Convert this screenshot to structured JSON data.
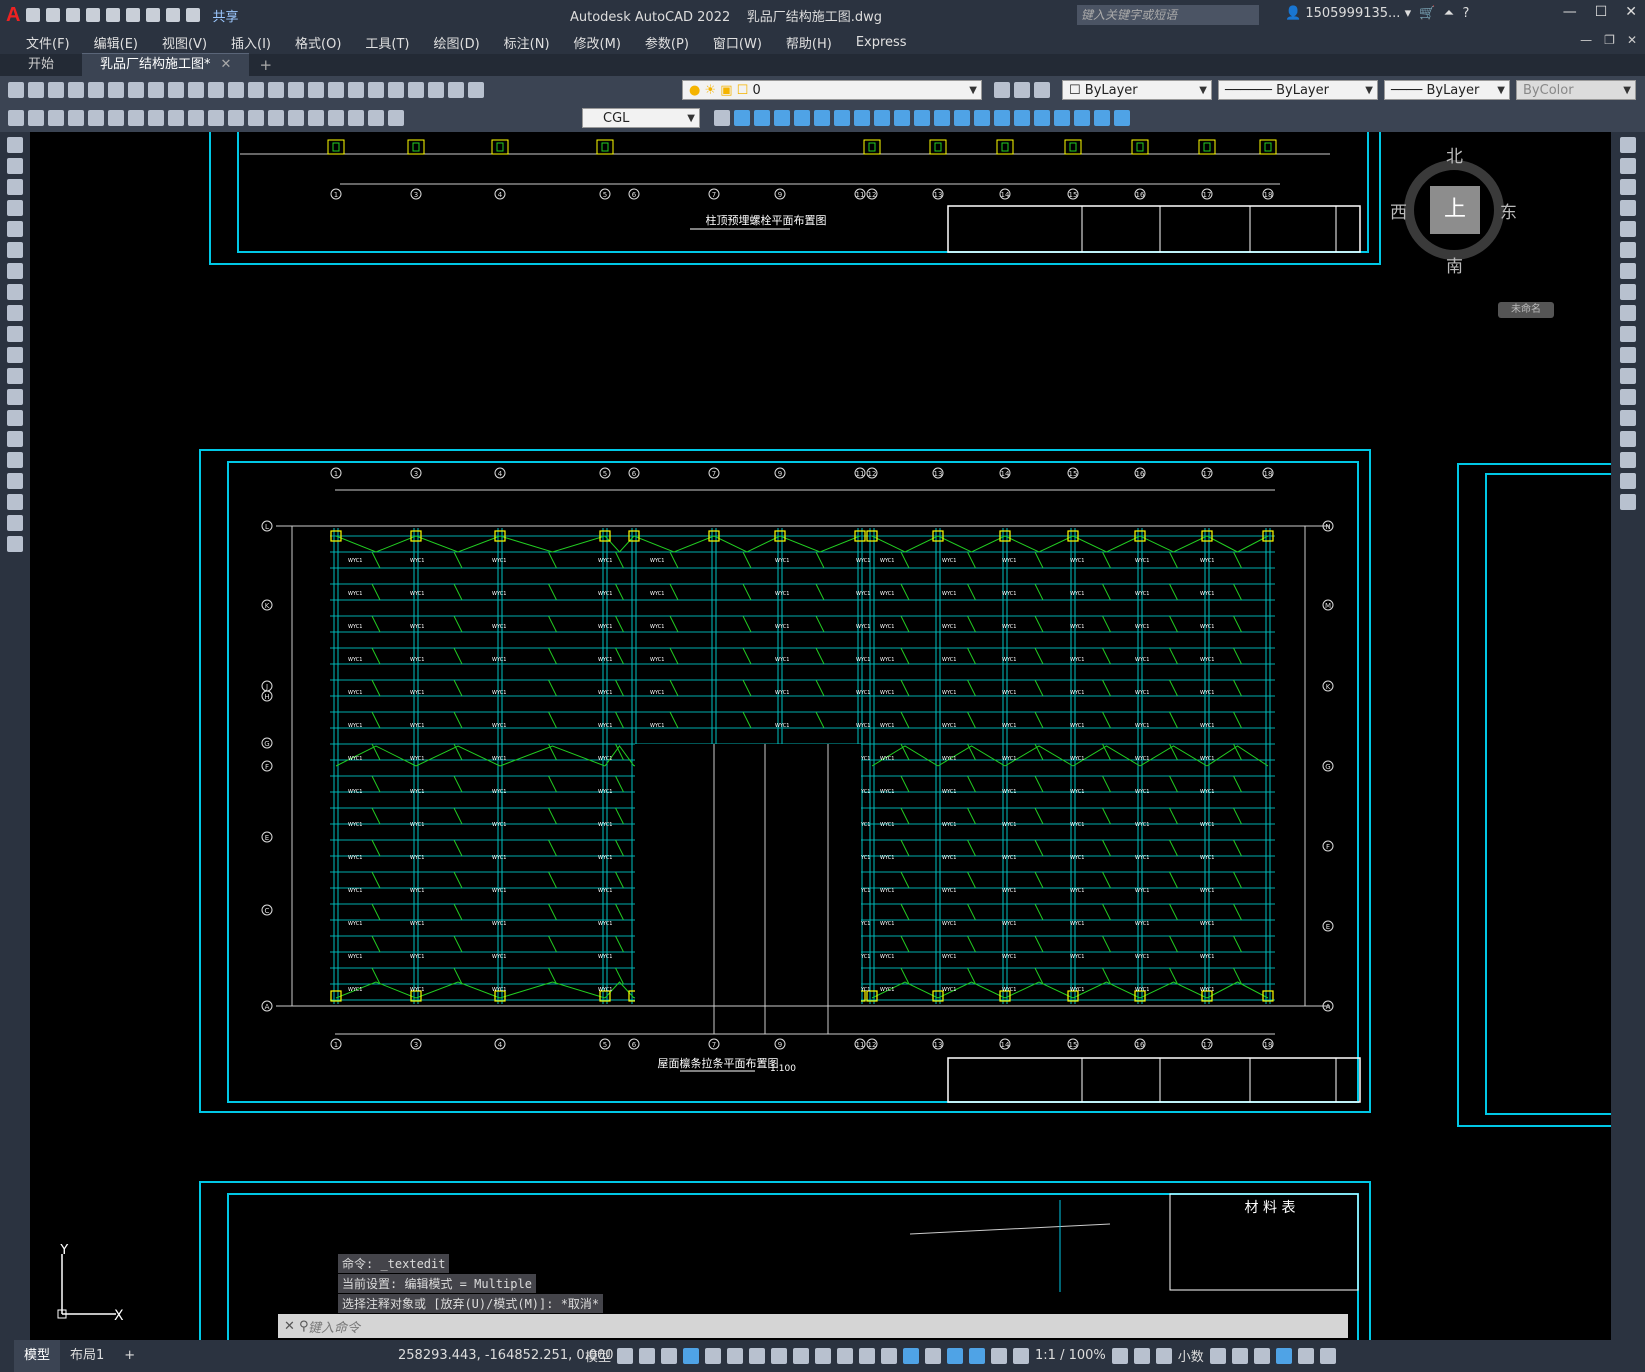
{
  "titlebar": {
    "app_title": "Autodesk AutoCAD 2022",
    "doc_title": "乳品厂结构施工图.dwg",
    "search_placeholder": "键入关键字或短语",
    "user": "1505999135...",
    "share_label": "共享"
  },
  "menu": [
    "文件(F)",
    "编辑(E)",
    "视图(V)",
    "插入(I)",
    "格式(O)",
    "工具(T)",
    "绘图(D)",
    "标注(N)",
    "修改(M)",
    "参数(P)",
    "窗口(W)",
    "帮助(H)",
    "Express"
  ],
  "tabs": {
    "start": "开始",
    "doc": "乳品厂结构施工图*"
  },
  "toolbar": {
    "layer_value": "0",
    "color_value": "ByLayer",
    "linetype_value": "ByLayer",
    "lineweight_value": "ByLayer",
    "plotstyle_value": "ByColor",
    "dimstyle_value": "CGL"
  },
  "viewcube": {
    "north": "北",
    "south": "南",
    "east": "东",
    "west": "西",
    "face": "上",
    "wcs": "未命名"
  },
  "drawing": {
    "title_top": "柱顶预埋螺栓平面布置图",
    "title_main": "屋面檩条拉条平面布置图",
    "scale_main": "1:100",
    "title_bottom_table": "材 料 表",
    "grid_numbers": [
      "1",
      "3",
      "4",
      "5",
      "6",
      "7",
      "9",
      "11",
      "12",
      "13",
      "14",
      "15",
      "16",
      "17",
      "18"
    ],
    "grid_letters_left": [
      "L",
      "K",
      "J",
      "H",
      "G",
      "F",
      "E",
      "C",
      "A"
    ],
    "grid_letters_right": [
      "N",
      "M",
      "K",
      "G",
      "F",
      "E",
      "A"
    ],
    "purlin_tag": "WYC1"
  },
  "commandline": {
    "history": [
      "命令: _textedit",
      "当前设置: 编辑模式 = Multiple",
      "选择注释对象或 [放弃(U)/模式(M)]: *取消*"
    ],
    "input_placeholder": "键入命令"
  },
  "ucs": {
    "x": "X",
    "y": "Y"
  },
  "statusbar": {
    "tab_model": "模型",
    "tab_layout": "布局1",
    "coords": "258293.443, -164852.251, 0.000",
    "space": "模型",
    "annoscale": "1:1 / 100%",
    "units": "小数"
  },
  "colors": {
    "frame": "#00c8e6",
    "purlin": "#22cc22",
    "column": "#ffff00",
    "rafter": "#00bfbf"
  }
}
